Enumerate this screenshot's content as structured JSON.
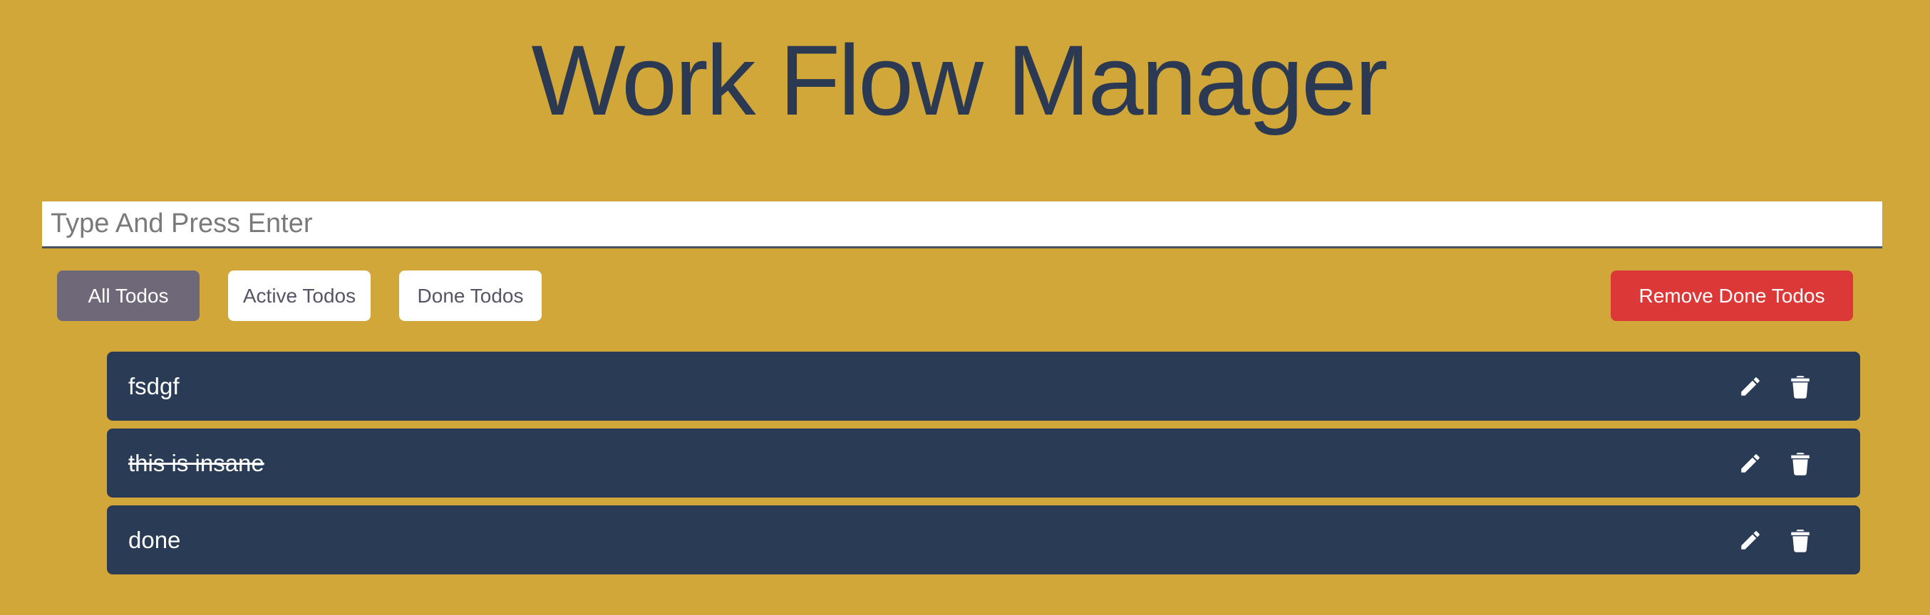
{
  "header": {
    "title": "Work Flow Manager"
  },
  "input": {
    "placeholder": "Type And Press Enter",
    "value": ""
  },
  "filters": {
    "all_label": "All Todos",
    "active_label": "Active Todos",
    "done_label": "Done Todos",
    "selected": "All Todos"
  },
  "actions": {
    "remove_done_label": "Remove Done Todos"
  },
  "todos": [
    {
      "text": "fsdgf",
      "done": false
    },
    {
      "text": "this is insane",
      "done": true
    },
    {
      "text": "done",
      "done": false
    }
  ],
  "icons": {
    "edit": "pencil-icon",
    "delete": "trash-icon"
  },
  "colors": {
    "background": "#D1A73A",
    "title": "#2B3A52",
    "todo_bg": "#293B55",
    "selected_filter": "#6E6879",
    "remove_button": "#DC3838"
  }
}
